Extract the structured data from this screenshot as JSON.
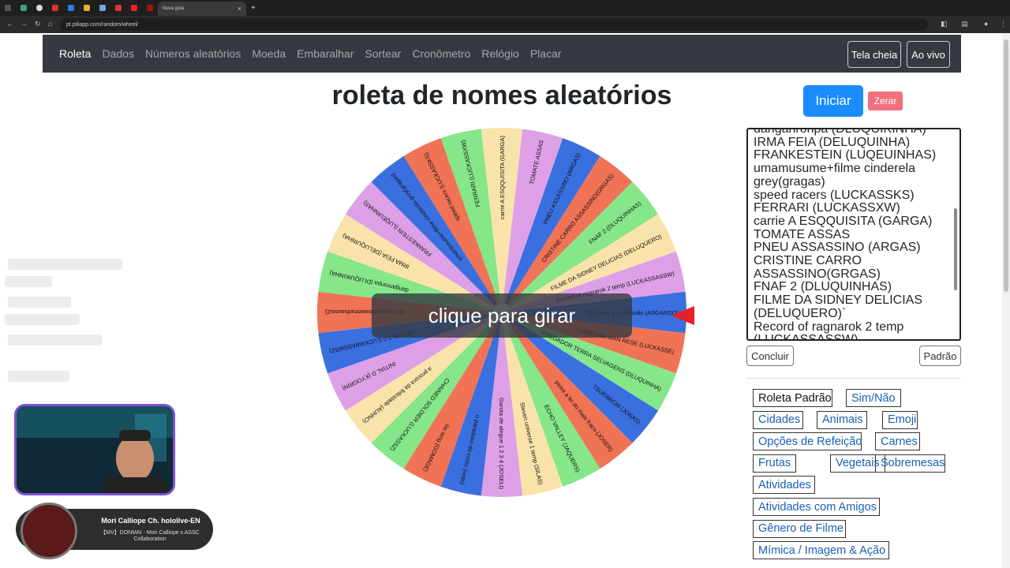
{
  "browser": {
    "active_tab_title": "Nova guia",
    "url": "pt.piliapp.com/random/wheel/"
  },
  "nav": {
    "links": [
      "Roleta",
      "Dados",
      "Números aleatórios",
      "Moeda",
      "Embaralhar",
      "Sortear",
      "Cronômetro",
      "Relógio",
      "Placar"
    ],
    "fullscreen_label": "Tela cheia",
    "live_label": "Ao vivo"
  },
  "page": {
    "title": "roleta de nomes aleatórios",
    "spin_prompt": "clique para girar",
    "start_label": "Iniciar",
    "reset_label": "Zerar",
    "done_label": "Concluir",
    "default_label": "Padrão"
  },
  "names_list": [
    "danganronpa (DLUQUIKINHA)",
    "IRMA FEIA (DELUQUINHA)",
    "FRANKESTEIN (LUQEUINHAS)",
    "umamusume+filme cinderela",
    "grey(gragas)",
    "speed racers (LUCKASSKS)",
    "FERRARI (LUCKASSXW)",
    "carrie A ESQQUISITA (GARGA)",
    "TOMATE ASSAS",
    "PNEU ASSASSINO (ARGAS)",
    "CRISTINE CARRO",
    "ASSASSINO(GRGAS)",
    "FNAF 2 (DLUQUINHAS)",
    "FILME DA SIDNEY DELICIAS",
    "(DELUQUERO)`",
    "Record of ragnarok 2 temp",
    "(LUCKASSASSW)"
  ],
  "wheel": {
    "segments": [
      {
        "label": "Top Gang 2 - a Missão (ASGARDO)",
        "color": "#3a6fe0"
      },
      {
        "label": "CHAINSAW MAN RESE (LUCKASSE)",
        "color": "#f07356"
      },
      {
        "label": "PREDADOR TERRA SELVAGENS (DLUQUINHA)",
        "color": "#86e68a"
      },
      {
        "label": "TSUKIMICHI (JONAS)",
        "color": "#3a6fe0"
      },
      {
        "label": "peixe a lei do mais fraco (JOSER)",
        "color": "#f07356"
      },
      {
        "label": "ECHO VALLEY (JAQUERS)",
        "color": "#86e68a"
      },
      {
        "label": "Steven universe 1 temp (SILAS)",
        "color": "#fae3aa"
      },
      {
        "label": "Garota de alegue 1 2 3 4 (JOSELI)",
        "color": "#dda0e6"
      },
      {
        "label": "o paradoxo do cristo (ivojo)",
        "color": "#3a6fe0"
      },
      {
        "label": "lilo leng (GOMAGE)",
        "color": "#f07356"
      },
      {
        "label": "CHAINED SOLDIER (LUCKASSZ)",
        "color": "#86e68a"
      },
      {
        "label": "a procura da felicidade (AUHNO)",
        "color": "#fae3aa"
      },
      {
        "label": "INITIAL D (KYOGRIN)",
        "color": "#dda0e6"
      },
      {
        "label": "MEGAN 2.0 (LUCKAWASSWSZ)",
        "color": "#3a6fe0"
      },
      {
        "label": "911 (luckassswaeewdsaaswZ)",
        "color": "#f07356"
      },
      {
        "label": "danganronpa (DLUQUIKINHA)",
        "color": "#86e68a"
      },
      {
        "label": "IRMA FEIA (DELUQUINHA)",
        "color": "#fae3aa"
      },
      {
        "label": "FRANKESTEIN (LUQEUINHAS)",
        "color": "#dda0e6"
      },
      {
        "label": "umamusume+filme cinderela grey(gragas)",
        "color": "#3a6fe0"
      },
      {
        "label": "speed racers (LUCKASSKS)",
        "color": "#f07356"
      },
      {
        "label": "FERRARI (LUCKASSXW)",
        "color": "#86e68a"
      },
      {
        "label": "carrie A ESQQUISITA (GARGA)",
        "color": "#fae3aa"
      },
      {
        "label": "TOMATE ASSAS",
        "color": "#dda0e6"
      },
      {
        "label": "PNEU ASSASSINO (ARGAS)",
        "color": "#3a6fe0"
      },
      {
        "label": "CRISTINE CARRO ASSASSINO(GRGAS)",
        "color": "#f07356"
      },
      {
        "label": "FNAF 2 (DLUQUINHAS)",
        "color": "#86e68a"
      },
      {
        "label": "FILME DA SIDNEY DELICIAS (DELUQUERO)",
        "color": "#fae3aa"
      },
      {
        "label": "Record of ragnarok 2 temp (LUCKASSASSW)",
        "color": "#dda0e6"
      }
    ],
    "pointer_color": "#e8202a"
  },
  "presets": [
    {
      "label": "Roleta Padrão"
    },
    {
      "label": "Sim/Não"
    },
    {
      "label": "Cidades"
    },
    {
      "label": "Animais"
    },
    {
      "label": "Emoji"
    },
    {
      "label": "Opções de Refeição"
    },
    {
      "label": "Carnes"
    },
    {
      "label": "Frutas"
    },
    {
      "label": "Vegetais"
    },
    {
      "label": "Sobremesas"
    },
    {
      "label": "Atividades"
    },
    {
      "label": "Atividades com Amigos"
    },
    {
      "label": "Gênero de Filme"
    },
    {
      "label": "Mímica / Imagem & Ação"
    }
  ],
  "music": {
    "artist": "Mori Calliope Ch. hololive-EN",
    "track": "【MV】DONMAI - Mori Calliope x ASSC Collaboration"
  },
  "colors": {
    "navbar": "#343a40",
    "primary": "#1a8cff",
    "danger": "#f1707c"
  }
}
